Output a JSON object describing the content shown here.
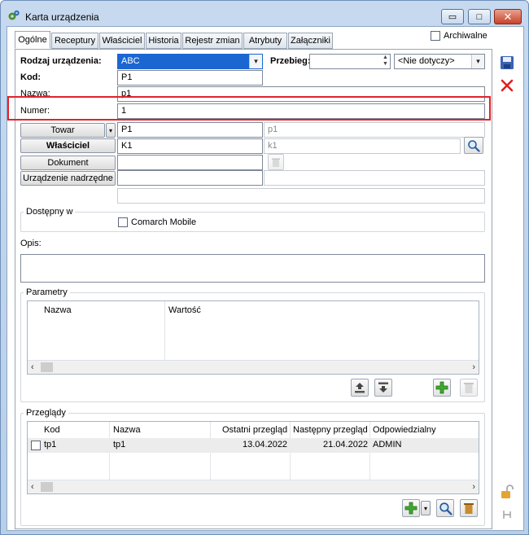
{
  "window": {
    "title": "Karta urządzenia",
    "minimize": "▭",
    "maximize": "□",
    "close": "✕"
  },
  "tabs": [
    {
      "label": "Ogólne",
      "active": true
    },
    {
      "label": "Receptury"
    },
    {
      "label": "Właściciel"
    },
    {
      "label": "Historia"
    },
    {
      "label": "Rejestr zmian"
    },
    {
      "label": "Atrybuty"
    },
    {
      "label": "Załączniki"
    }
  ],
  "archiwalne_label": "Archiwalne",
  "form": {
    "rodzaj_label": "Rodzaj urządzenia:",
    "rodzaj_value": "ABC",
    "przebieg_label": "Przebieg:",
    "przebieg_value": "",
    "przebieg_unit": "<Nie dotyczy>",
    "kod_label": "Kod:",
    "kod_value": "P1",
    "nazwa_label": "Nazwa:",
    "nazwa_value": "p1",
    "numer_label": "Numer:",
    "numer_value": "1",
    "towar_button": "Towar",
    "towar_code": "P1",
    "towar_name": "p1",
    "wlasciciel_button": "Właściciel",
    "wlasciciel_code": "K1",
    "wlasciciel_name": "k1",
    "dokument_button": "Dokument",
    "dokument_value": "",
    "urzadzenie_nadrzedne_button": "Urządzenie nadrzędne",
    "urzadzenie_nadrzedne_value": ""
  },
  "dostepny": {
    "title": "Dostępny w",
    "comarch_mobile": "Comarch Mobile"
  },
  "opis_label": "Opis:",
  "parametry": {
    "title": "Parametry",
    "columns": [
      "Nazwa",
      "Wartość"
    ]
  },
  "przeglady": {
    "title": "Przeglądy",
    "columns": [
      "Kod",
      "Nazwa",
      "Ostatni przegląd",
      "Następny przegląd",
      "Odpowiedzialny"
    ],
    "rows": [
      {
        "kod": "tp1",
        "nazwa": "tp1",
        "ostatni": "13.04.2022",
        "nastepny": "21.04.2022",
        "odpowiedzialny": "ADMIN"
      }
    ]
  },
  "colors": {
    "selection": "#1c66d2",
    "highlight_border": "#e0232b",
    "add_green": "#3fa92f",
    "delete_red": "#e02020",
    "save_blue": "#3a62b4"
  }
}
